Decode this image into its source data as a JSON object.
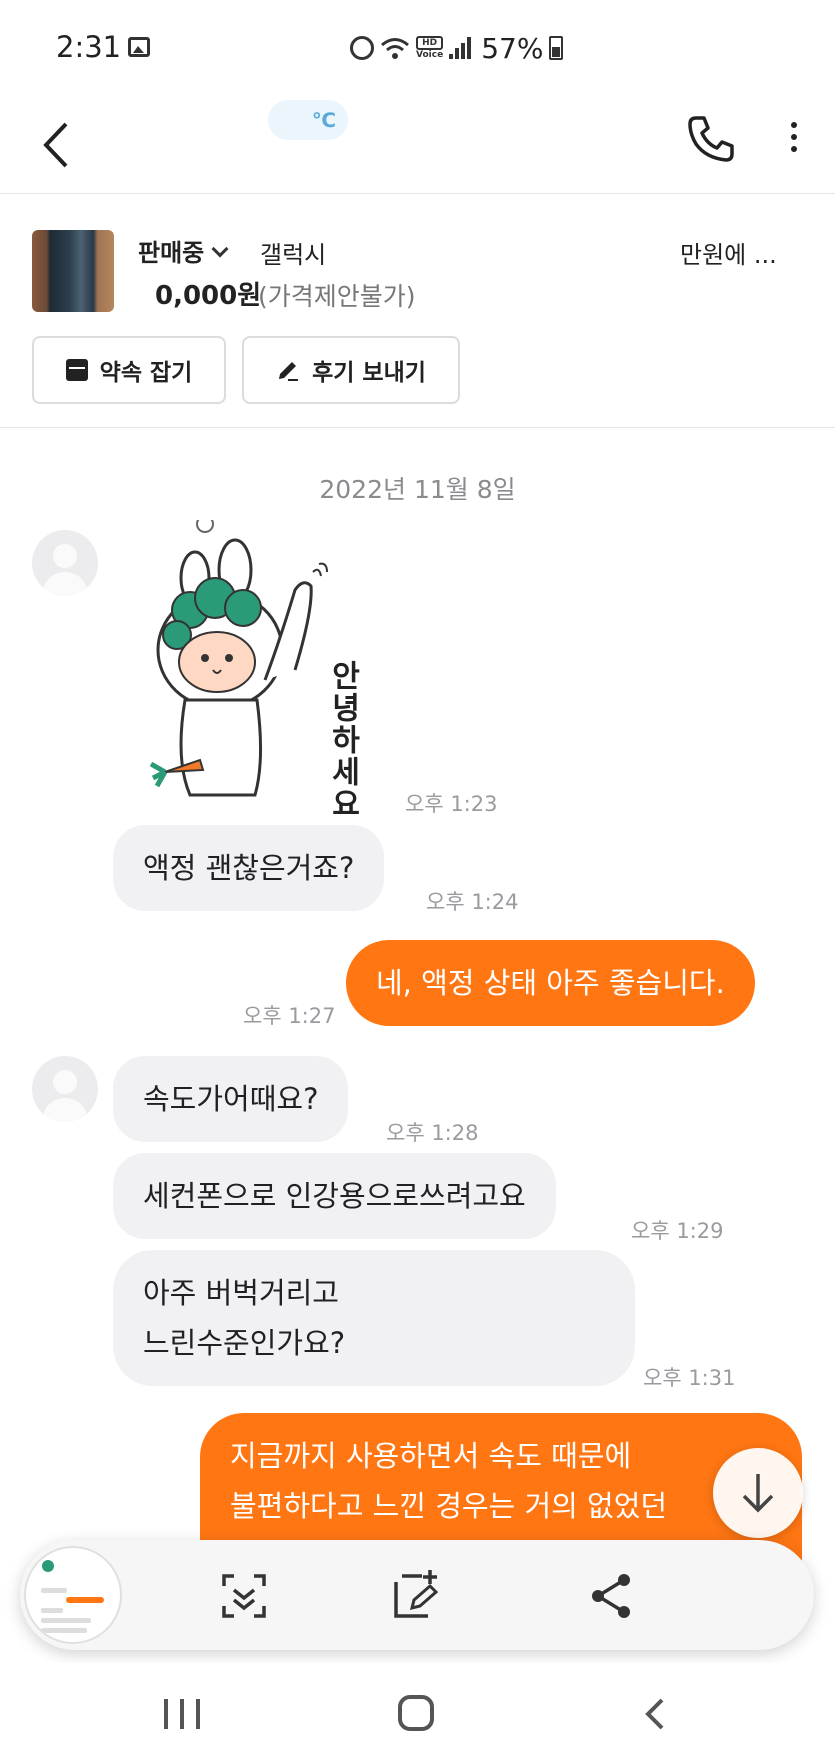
{
  "status_bar": {
    "time": "2:31",
    "hd_top": "HD",
    "hd_bottom": "Voice",
    "battery": "57%",
    "icons": [
      "gallery-icon",
      "alarm-icon",
      "wifi-icon",
      "signal-icon",
      "battery-icon"
    ]
  },
  "header": {
    "temperature_unit": "℃",
    "icons": [
      "back-icon",
      "phone-icon",
      "more-icon"
    ]
  },
  "product": {
    "status": "판매중",
    "title_start": "갤럭시",
    "title_end": "만원에 ...",
    "price": "0,000원",
    "negotiable": "(가격제안불가)",
    "buttons": {
      "appointment": "약속 잡기",
      "review": "후기 보내기"
    }
  },
  "chat": {
    "date": "2022년 11월 8일",
    "sticker_text": "안녕하세요",
    "sticker_time": "오후 1:23",
    "messages": [
      {
        "side": "in",
        "text": "액정 괜찮은거죠?",
        "time": "오후 1:24"
      },
      {
        "side": "out",
        "text": "네, 액정 상태 아주 좋습니다.",
        "time": "오후 1:27"
      },
      {
        "side": "in",
        "text": "속도가어때요?",
        "time": "오후 1:28"
      },
      {
        "side": "in",
        "text": "세컨폰으로 인강용으로쓰려고요",
        "time": "오후 1:29"
      },
      {
        "side": "in",
        "text_line1": "아주 버벅거리고",
        "text_line2": "느린수준인가요?",
        "time": "오후 1:31"
      },
      {
        "side": "out",
        "text_line1": "지금까지 사용하면서 속도 때문에",
        "text_line2": "불편하다고 느낀 경우는 거의 없었던"
      }
    ]
  },
  "screenshot_toolbar": {
    "icons": [
      "scroll-capture-icon",
      "edit-capture-icon",
      "share-icon"
    ]
  },
  "colors": {
    "accent": "#ff7613",
    "incoming_bubble": "#f1f1f4",
    "temperature": "#5aa9da"
  }
}
